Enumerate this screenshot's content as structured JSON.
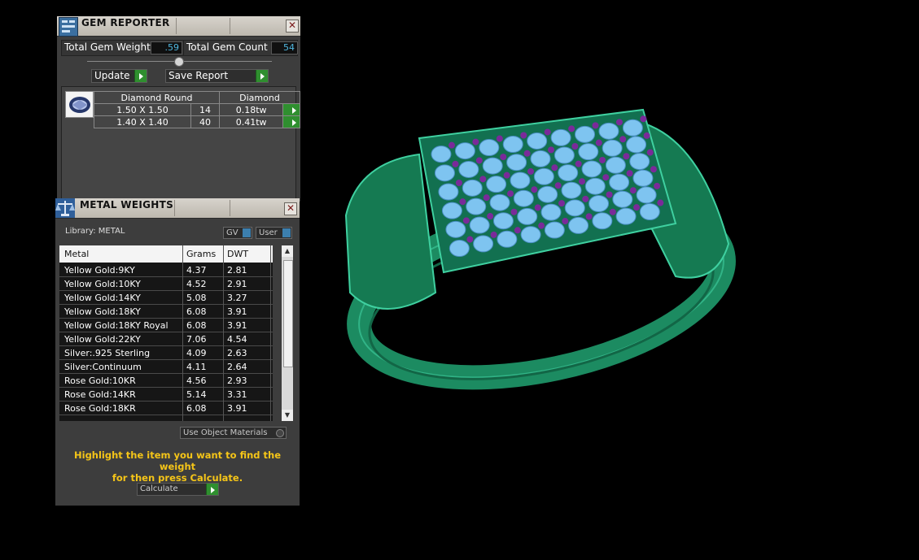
{
  "gem_reporter": {
    "title": "GEM REPORTER",
    "total_weight_label": "Total Gem Weight",
    "total_weight_value": ".59",
    "total_count_label": "Total Gem Count",
    "total_count_value": "54",
    "update_label": "Update",
    "save_report_label": "Save Report",
    "gem_header_shape": "Diamond Round",
    "gem_header_material": "Diamond",
    "gems": [
      {
        "size": "1.50 X 1.50",
        "count": "14",
        "weight": "0.18tw"
      },
      {
        "size": "1.40 X 1.40",
        "count": "40",
        "weight": "0.41tw"
      }
    ]
  },
  "metal_weights": {
    "title": "METAL WEIGHTS",
    "library_label": "Library: METAL",
    "gv_label": "GV",
    "user_label": "User",
    "columns": [
      "Metal",
      "Grams",
      "DWT"
    ],
    "rows": [
      {
        "metal": "Yellow Gold:9KY",
        "grams": "4.37",
        "dwt": "2.81"
      },
      {
        "metal": "Yellow Gold:10KY",
        "grams": "4.52",
        "dwt": "2.91"
      },
      {
        "metal": "Yellow Gold:14KY",
        "grams": "5.08",
        "dwt": "3.27"
      },
      {
        "metal": "Yellow Gold:18KY",
        "grams": "6.08",
        "dwt": "3.91"
      },
      {
        "metal": "Yellow Gold:18KY Royal",
        "grams": "6.08",
        "dwt": "3.91"
      },
      {
        "metal": "Yellow Gold:22KY",
        "grams": "7.06",
        "dwt": "4.54"
      },
      {
        "metal": "Silver:.925 Sterling",
        "grams": "4.09",
        "dwt": "2.63"
      },
      {
        "metal": "Silver:Continuum",
        "grams": "4.11",
        "dwt": "2.64"
      },
      {
        "metal": "Rose Gold:10KR",
        "grams": "4.56",
        "dwt": "2.93"
      },
      {
        "metal": "Rose Gold:14KR",
        "grams": "5.14",
        "dwt": "3.31"
      },
      {
        "metal": "Rose Gold:18KR",
        "grams": "6.08",
        "dwt": "3.91"
      }
    ],
    "use_object_materials_label": "Use Object Materials",
    "hint_line1": "Highlight the item you want to find the weight",
    "hint_line2": "for then press Calculate.",
    "calculate_label": "Calculate"
  },
  "colors": {
    "panel": "#3d3d3d",
    "ring_metal": "#1f9a6c",
    "gem_stone": "#7ec4f0",
    "prong": "#7a2a9a",
    "hint_text": "#f5c518"
  },
  "icons": [
    "gem-reporter-icon",
    "diamond-round-icon",
    "metal-weights-scale-icon",
    "close-icon",
    "play-arrow-icon"
  ]
}
